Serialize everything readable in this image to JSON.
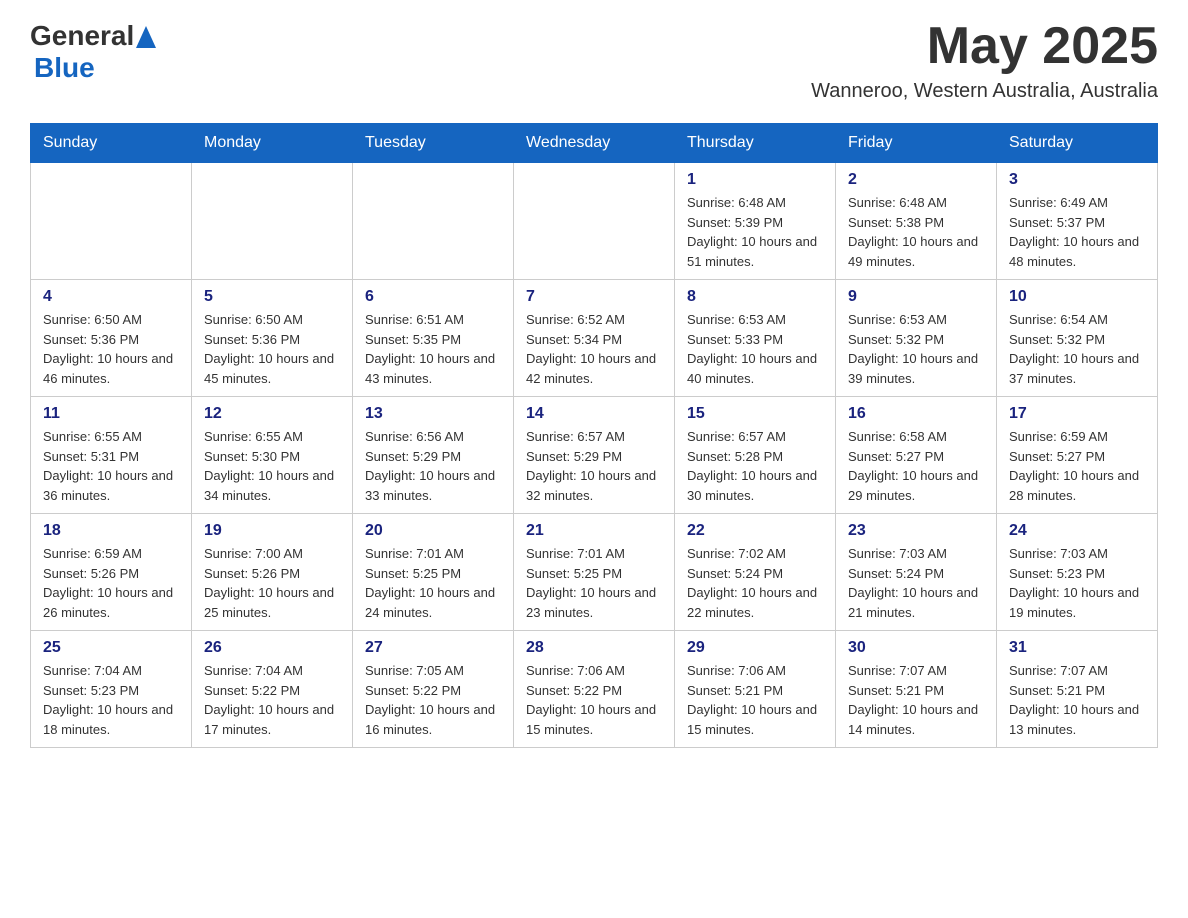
{
  "header": {
    "logo_general": "General",
    "logo_blue": "Blue",
    "month_title": "May 2025",
    "location": "Wanneroo, Western Australia, Australia"
  },
  "days_of_week": [
    "Sunday",
    "Monday",
    "Tuesday",
    "Wednesday",
    "Thursday",
    "Friday",
    "Saturday"
  ],
  "weeks": [
    [
      {
        "day": "",
        "sunrise": "",
        "sunset": "",
        "daylight": ""
      },
      {
        "day": "",
        "sunrise": "",
        "sunset": "",
        "daylight": ""
      },
      {
        "day": "",
        "sunrise": "",
        "sunset": "",
        "daylight": ""
      },
      {
        "day": "",
        "sunrise": "",
        "sunset": "",
        "daylight": ""
      },
      {
        "day": "1",
        "sunrise": "Sunrise: 6:48 AM",
        "sunset": "Sunset: 5:39 PM",
        "daylight": "Daylight: 10 hours and 51 minutes."
      },
      {
        "day": "2",
        "sunrise": "Sunrise: 6:48 AM",
        "sunset": "Sunset: 5:38 PM",
        "daylight": "Daylight: 10 hours and 49 minutes."
      },
      {
        "day": "3",
        "sunrise": "Sunrise: 6:49 AM",
        "sunset": "Sunset: 5:37 PM",
        "daylight": "Daylight: 10 hours and 48 minutes."
      }
    ],
    [
      {
        "day": "4",
        "sunrise": "Sunrise: 6:50 AM",
        "sunset": "Sunset: 5:36 PM",
        "daylight": "Daylight: 10 hours and 46 minutes."
      },
      {
        "day": "5",
        "sunrise": "Sunrise: 6:50 AM",
        "sunset": "Sunset: 5:36 PM",
        "daylight": "Daylight: 10 hours and 45 minutes."
      },
      {
        "day": "6",
        "sunrise": "Sunrise: 6:51 AM",
        "sunset": "Sunset: 5:35 PM",
        "daylight": "Daylight: 10 hours and 43 minutes."
      },
      {
        "day": "7",
        "sunrise": "Sunrise: 6:52 AM",
        "sunset": "Sunset: 5:34 PM",
        "daylight": "Daylight: 10 hours and 42 minutes."
      },
      {
        "day": "8",
        "sunrise": "Sunrise: 6:53 AM",
        "sunset": "Sunset: 5:33 PM",
        "daylight": "Daylight: 10 hours and 40 minutes."
      },
      {
        "day": "9",
        "sunrise": "Sunrise: 6:53 AM",
        "sunset": "Sunset: 5:32 PM",
        "daylight": "Daylight: 10 hours and 39 minutes."
      },
      {
        "day": "10",
        "sunrise": "Sunrise: 6:54 AM",
        "sunset": "Sunset: 5:32 PM",
        "daylight": "Daylight: 10 hours and 37 minutes."
      }
    ],
    [
      {
        "day": "11",
        "sunrise": "Sunrise: 6:55 AM",
        "sunset": "Sunset: 5:31 PM",
        "daylight": "Daylight: 10 hours and 36 minutes."
      },
      {
        "day": "12",
        "sunrise": "Sunrise: 6:55 AM",
        "sunset": "Sunset: 5:30 PM",
        "daylight": "Daylight: 10 hours and 34 minutes."
      },
      {
        "day": "13",
        "sunrise": "Sunrise: 6:56 AM",
        "sunset": "Sunset: 5:29 PM",
        "daylight": "Daylight: 10 hours and 33 minutes."
      },
      {
        "day": "14",
        "sunrise": "Sunrise: 6:57 AM",
        "sunset": "Sunset: 5:29 PM",
        "daylight": "Daylight: 10 hours and 32 minutes."
      },
      {
        "day": "15",
        "sunrise": "Sunrise: 6:57 AM",
        "sunset": "Sunset: 5:28 PM",
        "daylight": "Daylight: 10 hours and 30 minutes."
      },
      {
        "day": "16",
        "sunrise": "Sunrise: 6:58 AM",
        "sunset": "Sunset: 5:27 PM",
        "daylight": "Daylight: 10 hours and 29 minutes."
      },
      {
        "day": "17",
        "sunrise": "Sunrise: 6:59 AM",
        "sunset": "Sunset: 5:27 PM",
        "daylight": "Daylight: 10 hours and 28 minutes."
      }
    ],
    [
      {
        "day": "18",
        "sunrise": "Sunrise: 6:59 AM",
        "sunset": "Sunset: 5:26 PM",
        "daylight": "Daylight: 10 hours and 26 minutes."
      },
      {
        "day": "19",
        "sunrise": "Sunrise: 7:00 AM",
        "sunset": "Sunset: 5:26 PM",
        "daylight": "Daylight: 10 hours and 25 minutes."
      },
      {
        "day": "20",
        "sunrise": "Sunrise: 7:01 AM",
        "sunset": "Sunset: 5:25 PM",
        "daylight": "Daylight: 10 hours and 24 minutes."
      },
      {
        "day": "21",
        "sunrise": "Sunrise: 7:01 AM",
        "sunset": "Sunset: 5:25 PM",
        "daylight": "Daylight: 10 hours and 23 minutes."
      },
      {
        "day": "22",
        "sunrise": "Sunrise: 7:02 AM",
        "sunset": "Sunset: 5:24 PM",
        "daylight": "Daylight: 10 hours and 22 minutes."
      },
      {
        "day": "23",
        "sunrise": "Sunrise: 7:03 AM",
        "sunset": "Sunset: 5:24 PM",
        "daylight": "Daylight: 10 hours and 21 minutes."
      },
      {
        "day": "24",
        "sunrise": "Sunrise: 7:03 AM",
        "sunset": "Sunset: 5:23 PM",
        "daylight": "Daylight: 10 hours and 19 minutes."
      }
    ],
    [
      {
        "day": "25",
        "sunrise": "Sunrise: 7:04 AM",
        "sunset": "Sunset: 5:23 PM",
        "daylight": "Daylight: 10 hours and 18 minutes."
      },
      {
        "day": "26",
        "sunrise": "Sunrise: 7:04 AM",
        "sunset": "Sunset: 5:22 PM",
        "daylight": "Daylight: 10 hours and 17 minutes."
      },
      {
        "day": "27",
        "sunrise": "Sunrise: 7:05 AM",
        "sunset": "Sunset: 5:22 PM",
        "daylight": "Daylight: 10 hours and 16 minutes."
      },
      {
        "day": "28",
        "sunrise": "Sunrise: 7:06 AM",
        "sunset": "Sunset: 5:22 PM",
        "daylight": "Daylight: 10 hours and 15 minutes."
      },
      {
        "day": "29",
        "sunrise": "Sunrise: 7:06 AM",
        "sunset": "Sunset: 5:21 PM",
        "daylight": "Daylight: 10 hours and 15 minutes."
      },
      {
        "day": "30",
        "sunrise": "Sunrise: 7:07 AM",
        "sunset": "Sunset: 5:21 PM",
        "daylight": "Daylight: 10 hours and 14 minutes."
      },
      {
        "day": "31",
        "sunrise": "Sunrise: 7:07 AM",
        "sunset": "Sunset: 5:21 PM",
        "daylight": "Daylight: 10 hours and 13 minutes."
      }
    ]
  ]
}
